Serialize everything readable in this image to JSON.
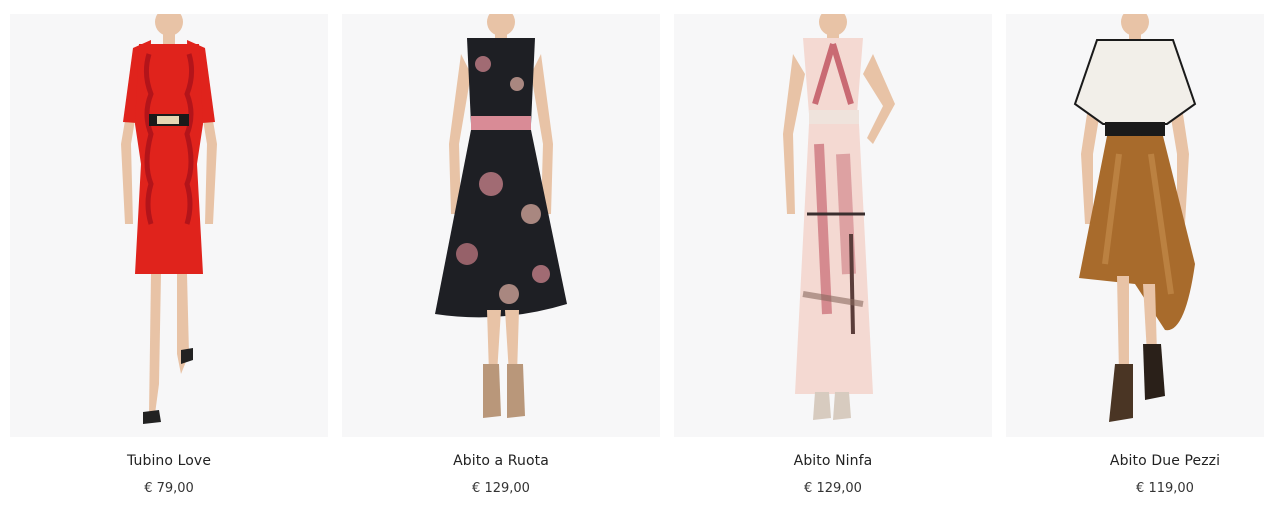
{
  "products": [
    {
      "name": "Tubino Love",
      "price": "€ 79,00",
      "image": "woman-in-red-ruffled-sheath-dress-with-gold-belt",
      "colors": {
        "dress": "#e0231c",
        "accent": "#c4161a"
      }
    },
    {
      "name": "Abito a Ruota",
      "price": "€ 129,00",
      "image": "woman-in-black-floral-print-midi-dress-with-pink-belt",
      "colors": {
        "dress": "#1e1f24",
        "accent": "#d98b96"
      }
    },
    {
      "name": "Abito Ninfa",
      "price": "€ 129,00",
      "image": "woman-in-pink-floral-print-maxi-dress",
      "colors": {
        "dress": "#f4d9d2",
        "accent": "#c96a73"
      }
    },
    {
      "name": "Abito Due Pezzi",
      "price": "€ 119,00",
      "image": "woman-in-white-top-and-bronze-satin-skirt-with-black-bow",
      "colors": {
        "top": "#f2efe9",
        "skirt": "#a86b2c",
        "bow": "#1a1a1a"
      }
    }
  ]
}
